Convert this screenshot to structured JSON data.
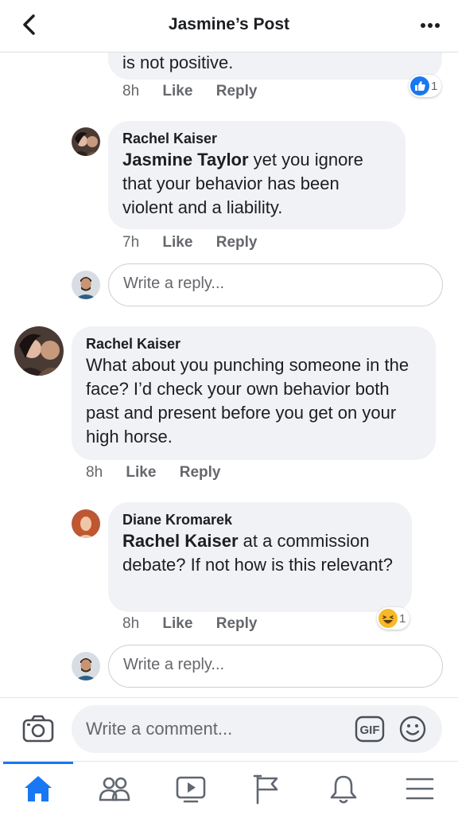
{
  "header": {
    "title": "Jasmine’s Post"
  },
  "colors": {
    "accent": "#1877f2",
    "bubble": "#f0f2f5",
    "meta": "#65676b"
  },
  "comment_top": {
    "text_tail": "is not positive.",
    "time": "8h",
    "like": "Like",
    "reply": "Reply",
    "reaction": {
      "icon": "thumbs-up",
      "count": "1"
    }
  },
  "reply1": {
    "author": "Rachel Kaiser",
    "mention": "Jasmine Taylor",
    "text": " yet you ignore that your behavior has been violent and a liability.",
    "time": "7h",
    "like": "Like",
    "reply": "Reply"
  },
  "reply_box_1": {
    "placeholder": "Write a reply..."
  },
  "comment2": {
    "author": "Rachel Kaiser",
    "text": "What about you punching someone in the face? I’d check your own behavior both past and present before you get on your high horse.",
    "time": "8h",
    "like": "Like",
    "reply": "Reply"
  },
  "reply2": {
    "author": "Diane Kromarek",
    "mention": "Rachel Kaiser",
    "text": " at a commission debate?  If not how is this relevant?",
    "time": "8h",
    "like": "Like",
    "reply": "Reply",
    "reaction": {
      "icon": "haha",
      "count": "1"
    }
  },
  "reply_box_2": {
    "placeholder": "Write a reply..."
  },
  "composer": {
    "placeholder": "Write a comment...",
    "gif": "GIF"
  },
  "tabs": [
    "home",
    "friends",
    "watch",
    "pages",
    "notifications",
    "menu"
  ]
}
